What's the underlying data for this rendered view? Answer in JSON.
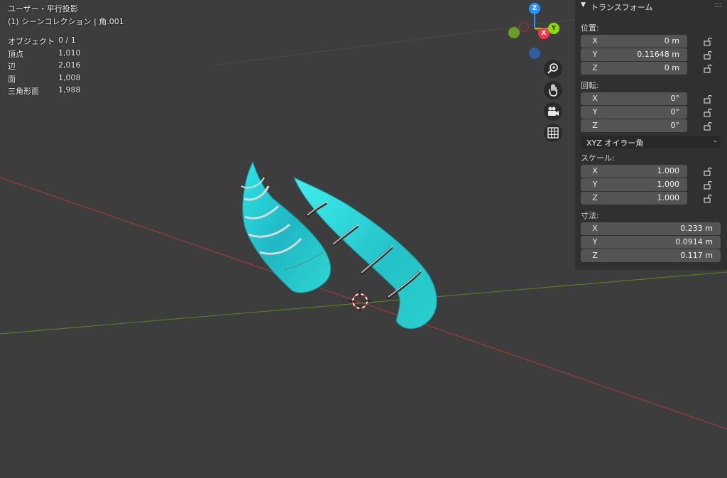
{
  "viewport": {
    "title": "ユーザー・平行投影",
    "subtitle": "(1) シーンコレクション | 角.001",
    "stats": [
      {
        "label": "オブジェクト",
        "value": "0 / 1"
      },
      {
        "label": "頂点",
        "value": "1,010"
      },
      {
        "label": "辺",
        "value": "2,016"
      },
      {
        "label": "面",
        "value": "1,008"
      },
      {
        "label": "三角形面",
        "value": "1,988"
      }
    ]
  },
  "gizmo": {
    "z": "Z",
    "x": "X",
    "y": "Y"
  },
  "nav_icons": [
    "zoom-icon",
    "hand-icon",
    "camera-icon",
    "grid-icon"
  ],
  "panel": {
    "title": "トランスフォーム",
    "location_label": "位置:",
    "location": [
      {
        "axis": "X",
        "value": "0 m"
      },
      {
        "axis": "Y",
        "value": "0.11648 m"
      },
      {
        "axis": "Z",
        "value": "0 m"
      }
    ],
    "rotation_label": "回転:",
    "rotation": [
      {
        "axis": "X",
        "value": "0°"
      },
      {
        "axis": "Y",
        "value": "0°"
      },
      {
        "axis": "Z",
        "value": "0°"
      }
    ],
    "rotation_mode": "XYZ オイラー角",
    "scale_label": "スケール:",
    "scale": [
      {
        "axis": "X",
        "value": "1.000"
      },
      {
        "axis": "Y",
        "value": "1.000"
      },
      {
        "axis": "Z",
        "value": "1.000"
      }
    ],
    "dimensions_label": "寸法:",
    "dimensions": [
      {
        "axis": "X",
        "value": "0.233 m"
      },
      {
        "axis": "Y",
        "value": "0.0914 m"
      },
      {
        "axis": "Z",
        "value": "0.117 m"
      }
    ]
  },
  "colors": {
    "background": "#3d3d3d",
    "x_axis": "#ff3352",
    "y_axis": "#8bdc00",
    "z_axis": "#2890ff",
    "object": "#33d6d6"
  }
}
